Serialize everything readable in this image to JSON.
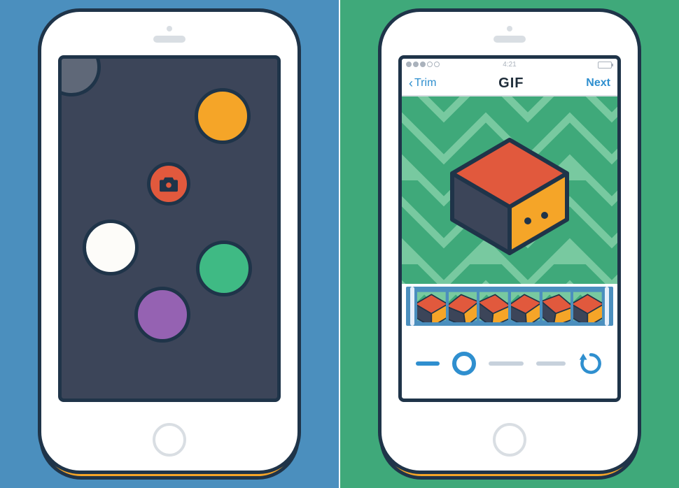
{
  "left_panel": {
    "screen": {
      "dots": [
        "grey",
        "orange",
        "white",
        "green",
        "purple"
      ],
      "shutter_icon": "camera-icon"
    }
  },
  "right_panel": {
    "statusbar": {
      "time": "4:21"
    },
    "navbar": {
      "back_label": "Trim",
      "title": "GIF",
      "next_label": "Next"
    },
    "filmstrip": {
      "frame_count": 6
    },
    "controls": {
      "loop_icon": "loop-icon"
    },
    "colors": {
      "accent_blue": "#2f8fcf",
      "chevron_dark": "#3fa97a",
      "chevron_light": "#78c9a0",
      "cube_top": "#e1593d",
      "cube_front": "#f5a528",
      "cube_side": "#3c4559",
      "outline": "#1f3449"
    }
  }
}
